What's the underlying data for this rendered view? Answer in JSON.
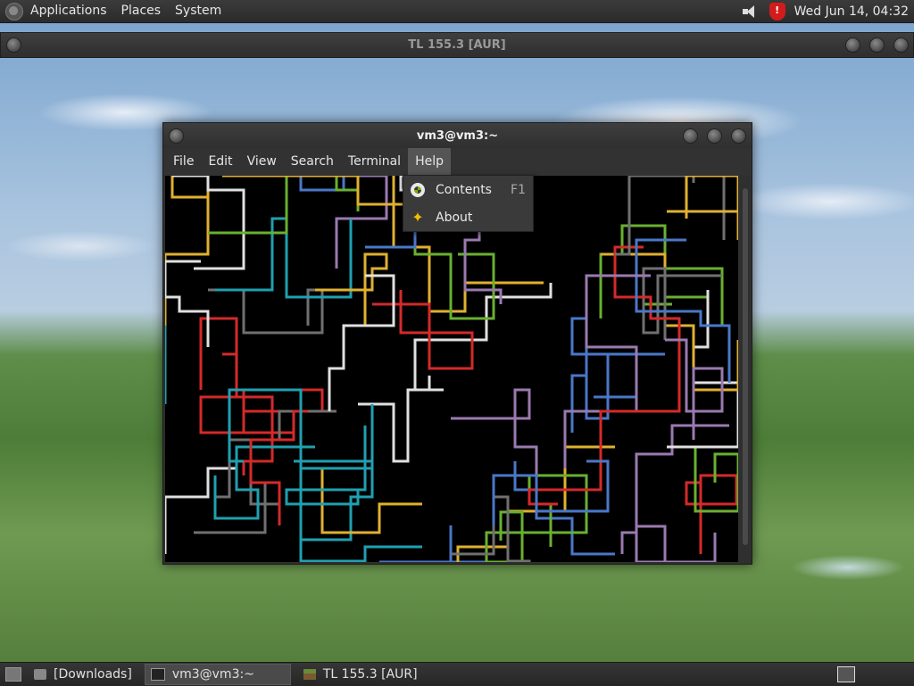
{
  "top_panel": {
    "menus": [
      "Applications",
      "Places",
      "System"
    ],
    "clock": "Wed Jun 14, 04:32"
  },
  "outer_window": {
    "title": "TL 155.3 [AUR]"
  },
  "terminal": {
    "title": "vm3@vm3:~",
    "menus": [
      "File",
      "Edit",
      "View",
      "Search",
      "Terminal",
      "Help"
    ],
    "active_menu": "Help"
  },
  "help_menu": {
    "items": [
      {
        "label": "Contents",
        "accel": "F1",
        "icon": "lifebuoy-icon"
      },
      {
        "label": "About",
        "accel": "",
        "icon": "star-icon"
      }
    ]
  },
  "taskbar": {
    "tasks": [
      {
        "label": "[Downloads]",
        "icon": "folder-icon",
        "active": false
      },
      {
        "label": "vm3@vm3:~",
        "icon": "terminal-icon",
        "active": true
      },
      {
        "label": "TL 155.3 [AUR]",
        "icon": "block-icon",
        "active": false
      }
    ]
  },
  "pipes_colors": [
    "#e0e0e0",
    "#d42a2a",
    "#e0b030",
    "#4a78c8",
    "#6ab030",
    "#9a7ab0",
    "#20a0b0",
    "#707070"
  ]
}
